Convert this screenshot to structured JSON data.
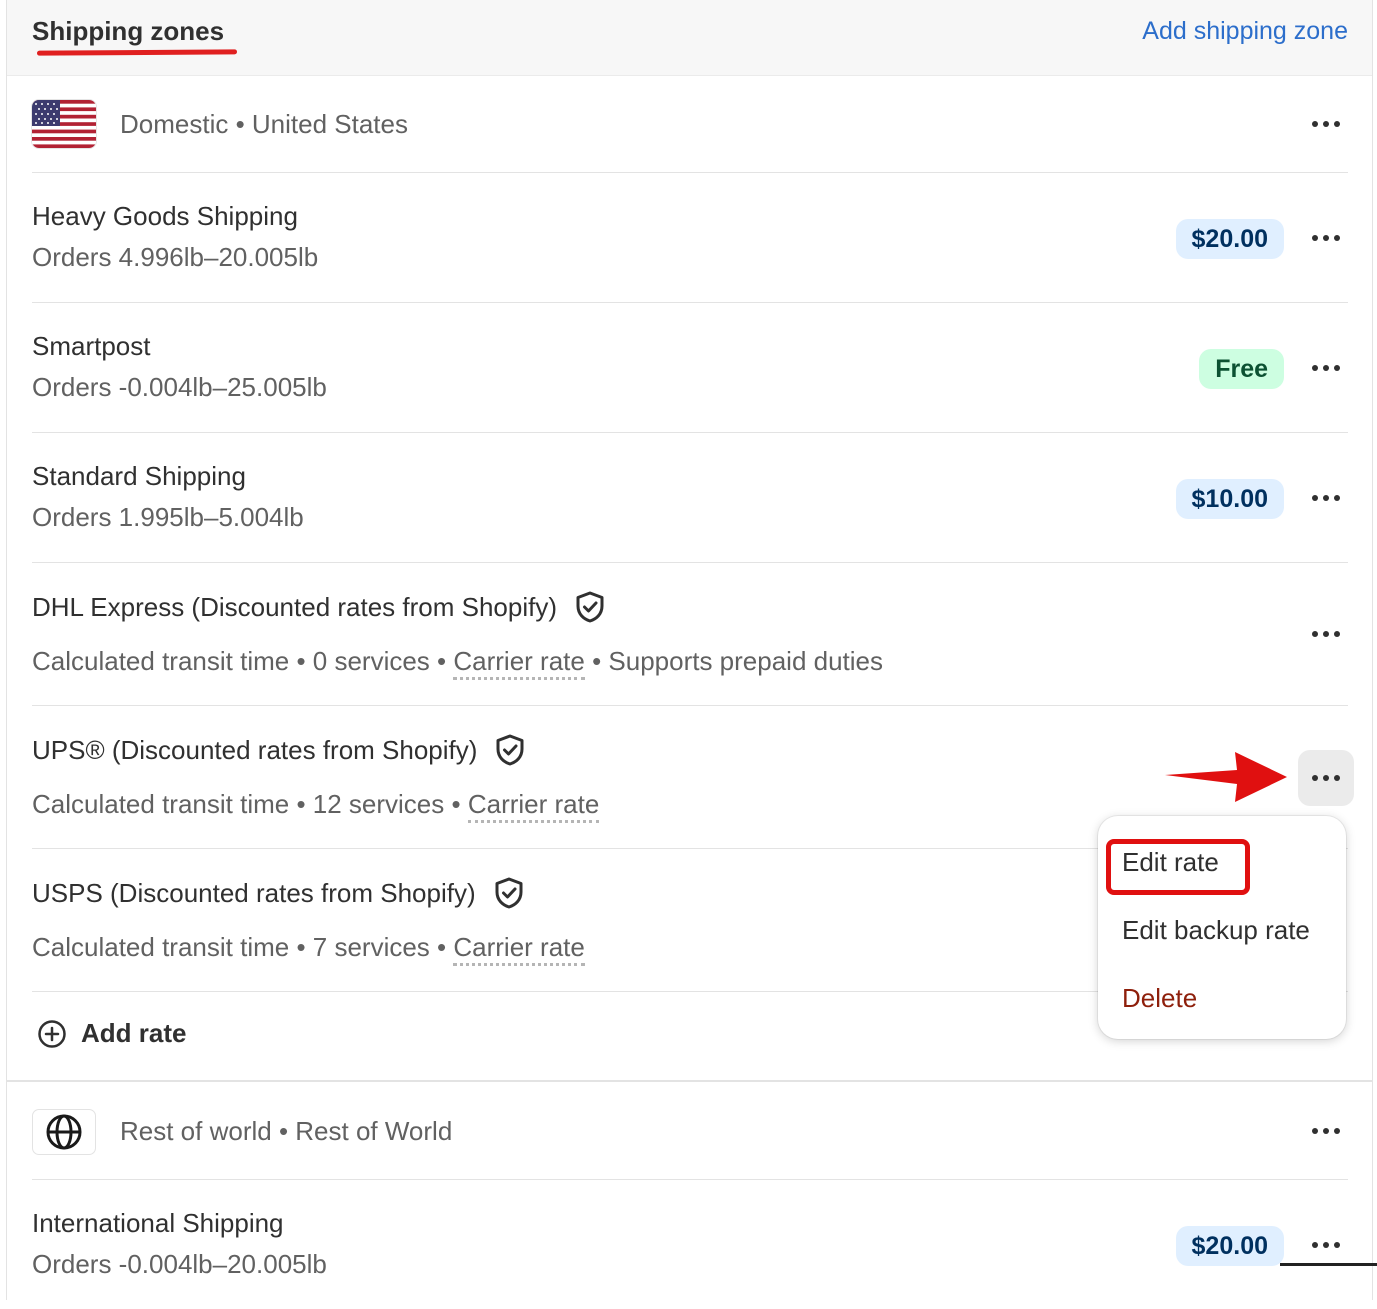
{
  "header": {
    "title": "Shipping zones",
    "add_zone_label": "Add shipping zone"
  },
  "zones": {
    "domestic": {
      "label": "Domestic • United States",
      "flag_icon": "us-flag-icon"
    },
    "rest_of_world": {
      "label": "Rest of world • Rest of World",
      "icon": "globe-icon"
    }
  },
  "rates": [
    {
      "name": "Heavy Goods Shipping",
      "sub": "Orders 4.996lb–20.005lb",
      "price": "$20.00"
    },
    {
      "name": "Smartpost",
      "sub": "Orders -0.004lb–25.005lb",
      "price": "Free"
    },
    {
      "name": "Standard Shipping",
      "sub": "Orders 1.995lb–5.004lb",
      "price": "$10.00"
    },
    {
      "name": "DHL Express (Discounted rates from Shopify)",
      "sub_a": "Calculated transit time • 0 services • ",
      "sub_link": "Carrier rate",
      "sub_b": " • Supports prepaid duties"
    },
    {
      "name": "UPS® (Discounted rates from Shopify)",
      "sub_a": "Calculated transit time • 12 services • ",
      "sub_link": "Carrier rate"
    },
    {
      "name": "USPS (Discounted rates from Shopify)",
      "sub_a": "Calculated transit time • 7 services • ",
      "sub_link": "Carrier rate"
    }
  ],
  "add_rate_label": "Add rate",
  "world_rates": [
    {
      "name": "International Shipping",
      "sub": "Orders -0.004lb–20.005lb",
      "price": "$20.00"
    }
  ],
  "menu": {
    "edit_rate": "Edit rate",
    "edit_backup_rate": "Edit backup rate",
    "delete": "Delete"
  },
  "colors": {
    "link": "#2c6ecb",
    "badge_blue": "#e0efff",
    "badge_green": "#cdfee1",
    "annotation_red": "#e01010",
    "delete_red": "#8e1f0b"
  }
}
